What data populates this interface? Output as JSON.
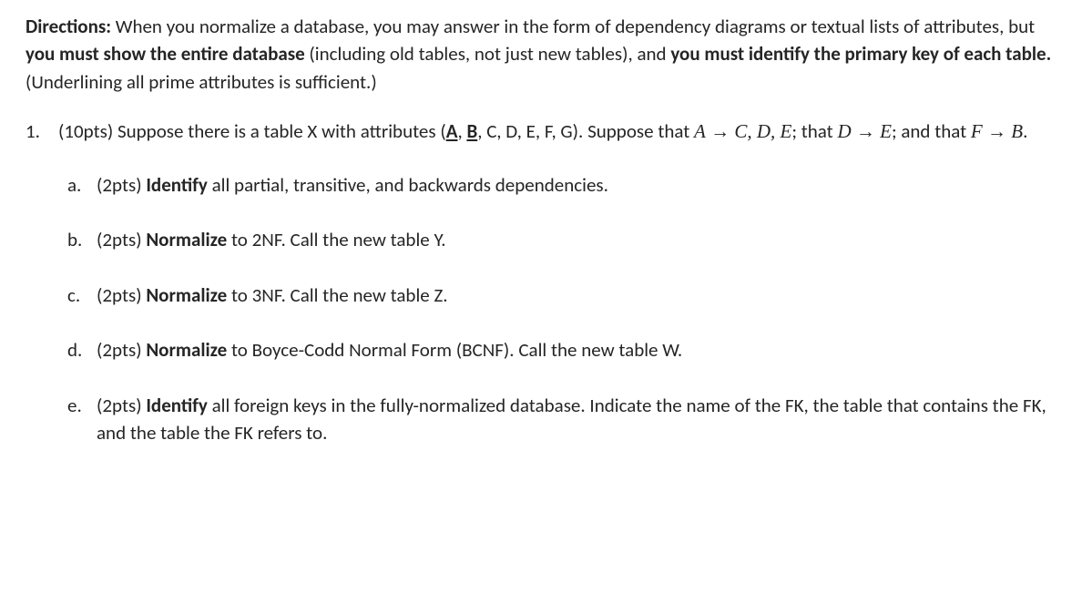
{
  "directions": {
    "label": "Directions:",
    "text1": " When you normalize a database, you may answer in the form of dependency diagrams or textual lists of attributes, but ",
    "bold1": "you must show the entire database",
    "text2": " (including old tables, not just new tables), and ",
    "bold2": "you must identify the primary key of each table.",
    "text3": " (Underlining all prime attributes is sufficient.)"
  },
  "question": {
    "number": "1.",
    "lead": "(10pts) Suppose there is a table X with attributes (",
    "pkA": "A",
    "sepAB": ", ",
    "pkB": "B",
    "afterPK": ", C, D, E, F, G). Suppose that ",
    "fd1_lhs": "A",
    "arrow": " → ",
    "fd1_rhs": "C, D, E",
    "afterFD1": "; that ",
    "fd2_lhs": "D",
    "fd2_rhs": "E",
    "afterFD2": "; and that ",
    "fd3_lhs": "F",
    "fd3_rhs": "B",
    "period": "."
  },
  "subitems": {
    "a": {
      "letter": "a.",
      "pts": "(2pts) ",
      "bold": "Identify",
      "rest": " all partial, transitive, and backwards dependencies."
    },
    "b": {
      "letter": "b.",
      "pts": "(2pts) ",
      "bold": "Normalize",
      "rest": " to 2NF. Call the new table Y."
    },
    "c": {
      "letter": "c.",
      "pts": "(2pts) ",
      "bold": "Normalize",
      "rest": " to 3NF. Call the new table Z."
    },
    "d": {
      "letter": "d.",
      "pts": "(2pts) ",
      "bold": "Normalize",
      "rest": " to Boyce-Codd Normal Form (BCNF). Call the new table W."
    },
    "e": {
      "letter": "e.",
      "pts": "(2pts) ",
      "bold": "Identify",
      "rest": " all foreign keys in the fully-normalized database. Indicate the name of the FK, the table that contains the FK, and the table the FK refers to."
    }
  }
}
